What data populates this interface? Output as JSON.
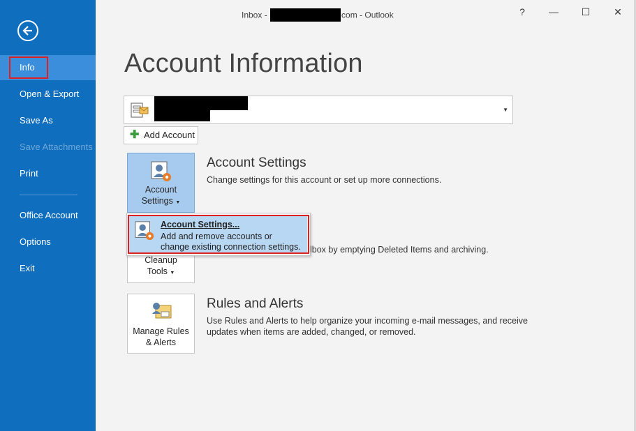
{
  "window": {
    "title_prefix": "Inbox - ",
    "title_suffix": "com - Outlook",
    "help": "?",
    "minimize": "—",
    "maximize": "☐",
    "close": "✕"
  },
  "sidebar": {
    "back_icon": "back-arrow-icon",
    "items": [
      {
        "label": "Info",
        "selected": true,
        "disabled": false
      },
      {
        "label": "Open & Export",
        "selected": false,
        "disabled": false
      },
      {
        "label": "Save As",
        "selected": false,
        "disabled": false
      },
      {
        "label": "Save Attachments",
        "selected": false,
        "disabled": true
      },
      {
        "label": "Print",
        "selected": false,
        "disabled": false
      },
      {
        "label": "Office Account",
        "selected": false,
        "disabled": false
      },
      {
        "label": "Options",
        "selected": false,
        "disabled": false
      },
      {
        "label": "Exit",
        "selected": false,
        "disabled": false
      }
    ]
  },
  "main": {
    "title": "Account Information",
    "add_account_label": "Add Account",
    "account_settings": {
      "button_line1": "Account",
      "button_line2": "Settings",
      "title": "Account Settings",
      "description": "Change settings for this account or set up more connections."
    },
    "cleanup": {
      "button_line1": "Cleanup",
      "button_line2": "Tools",
      "description_visible": "lbox by emptying Deleted Items and archiving."
    },
    "rules": {
      "button_line1": "Manage Rules",
      "button_line2": "& Alerts",
      "title": "Rules and Alerts",
      "description_line1": "Use Rules and Alerts to help organize your incoming e-mail messages, and receive",
      "description_line2": "updates when items are added, changed, or removed."
    },
    "dropdown_menu": {
      "item_title": "Account Settings...",
      "item_desc_line1": "Add and remove accounts or",
      "item_desc_line2": "change existing connection settings."
    }
  },
  "colors": {
    "sidebar_bg": "#106ebe",
    "sidebar_selected": "#3b8edb",
    "highlight_box": "#e02020",
    "active_button": "#a7cbee"
  }
}
